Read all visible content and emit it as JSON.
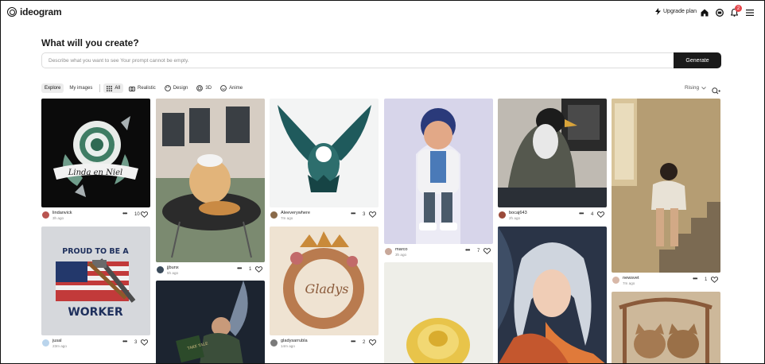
{
  "app": {
    "brand": "ideogram",
    "upgrade_label": "Upgrade plan",
    "notification_count": "2",
    "icons": [
      "bolt-icon",
      "home-icon",
      "feed-icon",
      "bell-icon",
      "menu-icon"
    ]
  },
  "hero": {
    "title": "What will you create?",
    "prompt_placeholder": "Describe what you want to see Your prompt cannot be empty.",
    "generate_label": "Generate"
  },
  "filters": {
    "scope": [
      "Explore",
      "My images"
    ],
    "categories": [
      "All",
      "Realistic",
      "Design",
      "3D",
      "Anime"
    ],
    "sort_label": "Rising"
  },
  "cards": [
    {
      "user": "lindanvick",
      "time": "3h ago",
      "likes": "10"
    },
    {
      "user": "jusal",
      "time": "23m ago",
      "likes": "3"
    },
    {
      "user": "jjbunx",
      "time": "5h ago",
      "likes": "1"
    },
    {
      "user": "Aleeverywhere",
      "time": "7m ago",
      "likes": "3"
    },
    {
      "user": "gladysarrubla",
      "time": "14m ago",
      "likes": "2"
    },
    {
      "user": "marco",
      "time": "3h ago",
      "likes": "7"
    },
    {
      "user": "bocaj643",
      "time": "2h ago",
      "likes": "4"
    },
    {
      "user": "newsvet",
      "time": "7m ago",
      "likes": "1"
    }
  ],
  "image_text": {
    "rose_banner": "Linda en Niel",
    "worker_top": "PROUD TO BE A",
    "worker_bottom": "WORKER",
    "gladys": "Gladys",
    "book": "TAKE TALE"
  },
  "colors": {
    "accent": "#1a1a1a",
    "badge": "#e5484d"
  }
}
